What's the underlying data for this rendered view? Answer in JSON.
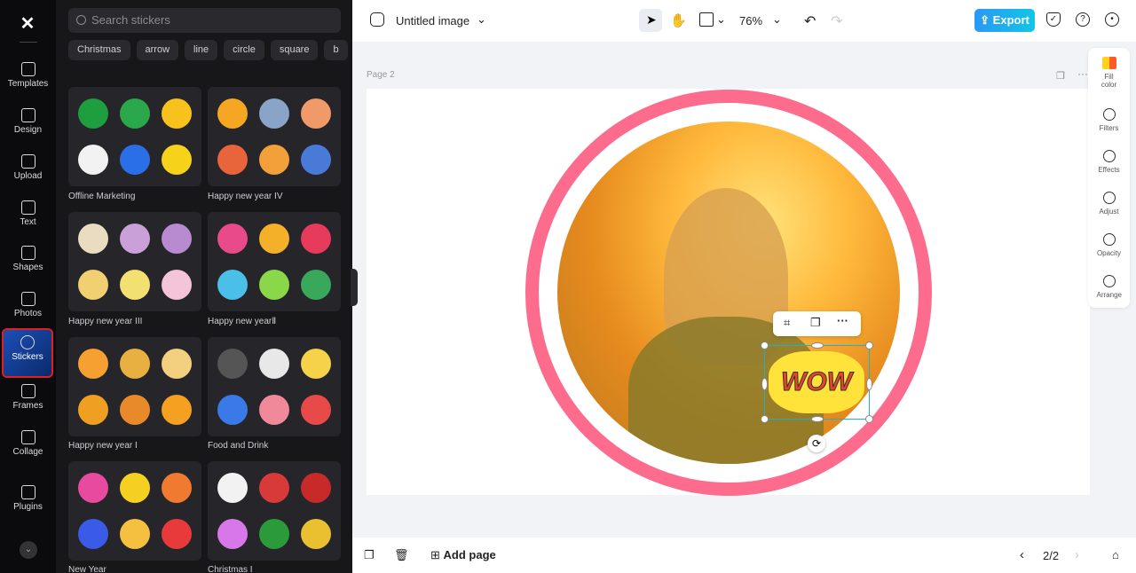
{
  "rail": {
    "items": [
      {
        "label": "Templates",
        "icon": "templates-icon"
      },
      {
        "label": "Design",
        "icon": "design-icon"
      },
      {
        "label": "Upload",
        "icon": "upload-icon"
      },
      {
        "label": "Text",
        "icon": "text-icon"
      },
      {
        "label": "Shapes",
        "icon": "shapes-icon"
      },
      {
        "label": "Photos",
        "icon": "photos-icon"
      },
      {
        "label": "Stickers",
        "icon": "stickers-icon",
        "active": true
      },
      {
        "label": "Frames",
        "icon": "frames-icon"
      },
      {
        "label": "Collage",
        "icon": "collage-icon"
      },
      {
        "label": "Plugins",
        "icon": "plugins-icon"
      }
    ]
  },
  "panel": {
    "search_placeholder": "Search stickers",
    "chips": [
      "Christmas",
      "arrow",
      "line",
      "circle",
      "square",
      "b"
    ],
    "packs": [
      "Offline Marketing",
      "Happy new year IV",
      "Happy new year III",
      "Happy new yearⅡ",
      "Happy new year I",
      "Food and Drink",
      "New Year",
      "Christmas I"
    ]
  },
  "header": {
    "title": "Untitled image",
    "zoom": "76%",
    "export": "Export"
  },
  "canvas": {
    "page_label": "Page 2",
    "sticker_text": "WOW"
  },
  "rightbar": [
    "Fill color",
    "Filters",
    "Effects",
    "Adjust",
    "Opacity",
    "Arrange"
  ],
  "bottom": {
    "add_page": "Add page",
    "page_counter": "2/2"
  },
  "colors": {
    "accent": "#1ab3c9",
    "ring": "#fd6c8c",
    "export": "#2a98f4"
  }
}
